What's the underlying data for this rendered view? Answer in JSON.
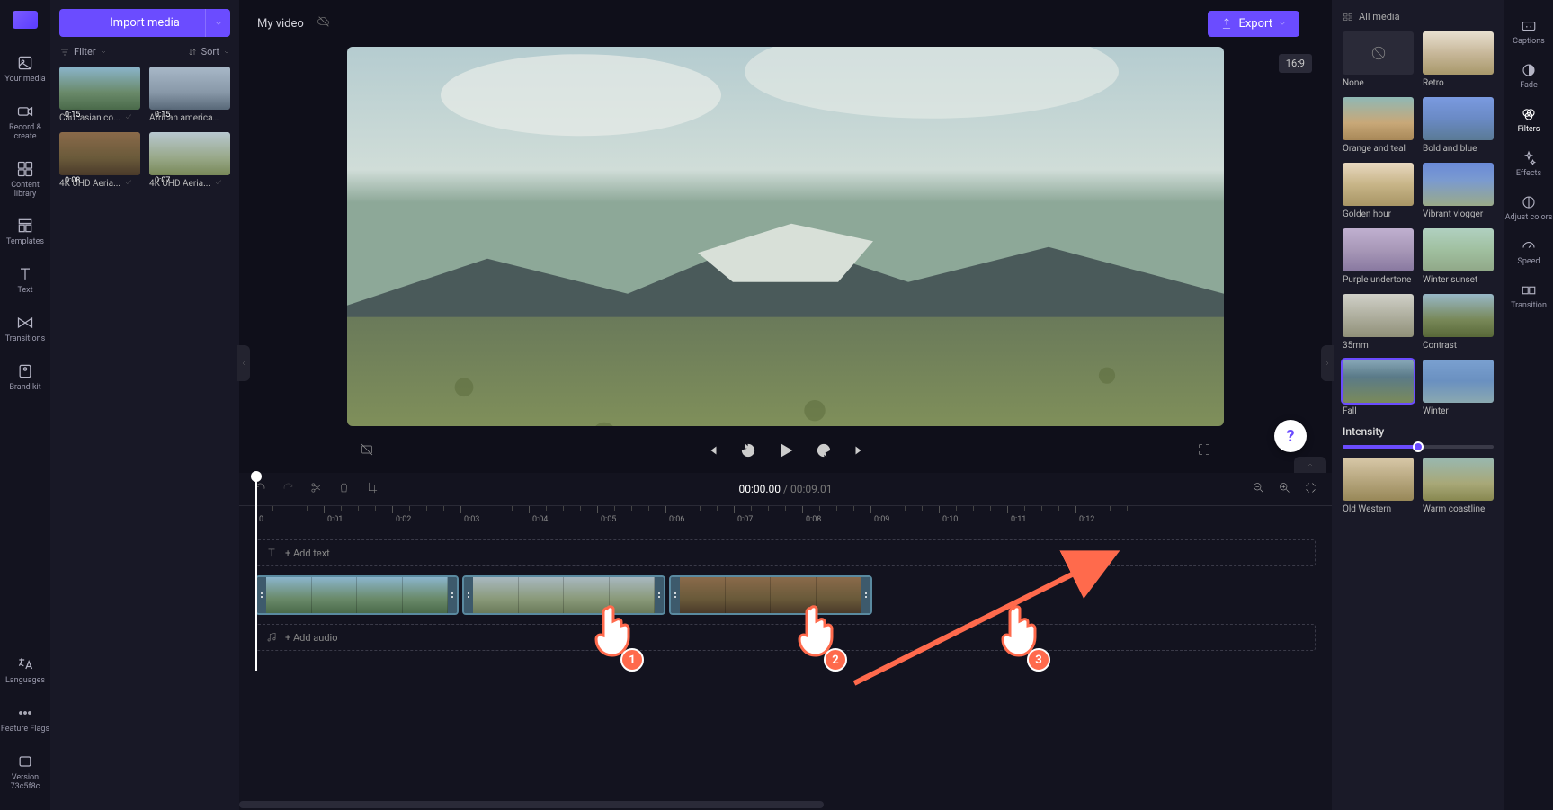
{
  "header": {
    "import_label": "Import media",
    "title": "My video",
    "export_label": "Export",
    "aspect_ratio": "16:9"
  },
  "left_rail": {
    "items": [
      {
        "id": "your-media",
        "label": "Your media"
      },
      {
        "id": "record-create",
        "label": "Record & create"
      },
      {
        "id": "content-library",
        "label": "Content library"
      },
      {
        "id": "templates",
        "label": "Templates"
      },
      {
        "id": "text",
        "label": "Text"
      },
      {
        "id": "transitions",
        "label": "Transitions"
      },
      {
        "id": "brand-kit",
        "label": "Brand kit"
      }
    ],
    "languages": "Languages",
    "feature_flags": "Feature Flags",
    "version": "Version 73c5f8c"
  },
  "media_panel": {
    "filter": "Filter",
    "sort": "Sort",
    "items": [
      {
        "duration": "0:15",
        "name": "Caucasian co..."
      },
      {
        "duration": "0:15",
        "name": "African american..."
      },
      {
        "duration": "0:08",
        "name": "4K UHD Aeria..."
      },
      {
        "duration": "0:07",
        "name": "4K UHD Aeria..."
      }
    ]
  },
  "right_rail": {
    "items": [
      {
        "id": "captions",
        "label": "Captions"
      },
      {
        "id": "fade",
        "label": "Fade"
      },
      {
        "id": "filters",
        "label": "Filters"
      },
      {
        "id": "effects",
        "label": "Effects"
      },
      {
        "id": "adjust-colors",
        "label": "Adjust colors"
      },
      {
        "id": "speed",
        "label": "Speed"
      },
      {
        "id": "transition",
        "label": "Transition"
      }
    ]
  },
  "filters_panel": {
    "header": "All media",
    "intensity_label": "Intensity",
    "intensity_value": 50,
    "selected": "Fall",
    "items": [
      {
        "id": "none",
        "label": "None"
      },
      {
        "id": "retro",
        "label": "Retro"
      },
      {
        "id": "orange-teal",
        "label": "Orange and teal"
      },
      {
        "id": "bold-blue",
        "label": "Bold and blue"
      },
      {
        "id": "golden",
        "label": "Golden hour"
      },
      {
        "id": "vibrant",
        "label": "Vibrant vlogger"
      },
      {
        "id": "purple",
        "label": "Purple undertone"
      },
      {
        "id": "winter-sunset",
        "label": "Winter sunset"
      },
      {
        "id": "mm35",
        "label": "35mm"
      },
      {
        "id": "contrast",
        "label": "Contrast"
      },
      {
        "id": "fall",
        "label": "Fall"
      },
      {
        "id": "winter",
        "label": "Winter"
      },
      {
        "id": "old-western",
        "label": "Old Western"
      },
      {
        "id": "warm-coast",
        "label": "Warm coastline"
      }
    ]
  },
  "timeline": {
    "current_time": "00:00.00",
    "total_time": "00:09.01",
    "add_text": "+ Add text",
    "add_audio": "+ Add audio",
    "ruler_labels": [
      "0",
      "0:01",
      "0:02",
      "0:03",
      "0:04",
      "0:05",
      "0:06",
      "0:07",
      "0:08",
      "0:09",
      "0:10",
      "0:11",
      "0:12"
    ]
  },
  "annotations": {
    "cursor1": "1",
    "cursor2": "2",
    "cursor3": "3"
  }
}
